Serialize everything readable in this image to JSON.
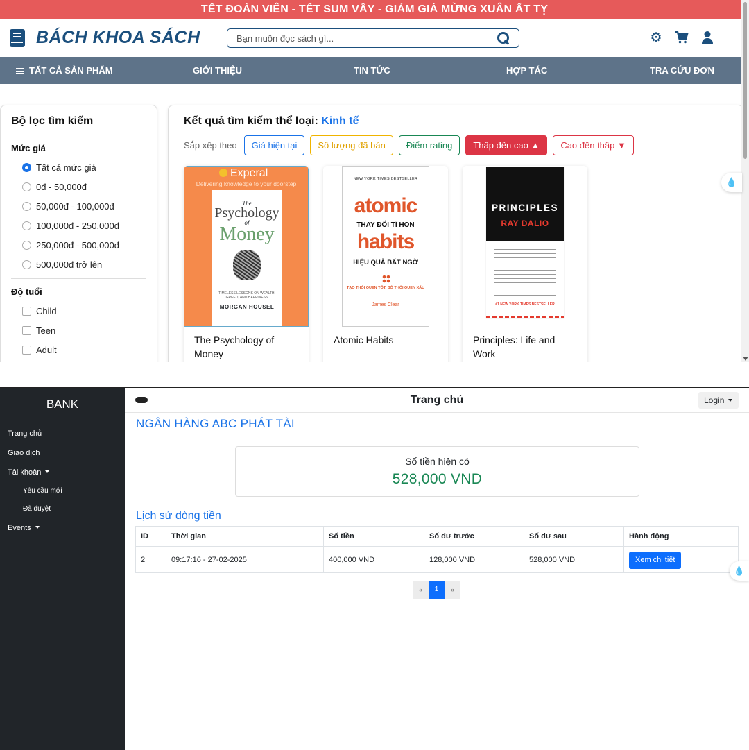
{
  "store": {
    "promo": "TẾT ĐOÀN VIÊN - TẾT SUM VẦY - GIẢM GIÁ MỪNG XUÂN ẤT TỴ",
    "logo": "BÁCH KHOA SÁCH",
    "search_placeholder": "Bạn muốn đọc sách gì...",
    "header_icons": [
      "gear-icon",
      "cart-icon",
      "user-icon"
    ],
    "nav": [
      "TẤT CẢ SẢN PHẨM",
      "GIỚI THIỆU",
      "TIN TỨC",
      "HỢP TÁC",
      "TRA CỨU ĐƠN"
    ],
    "filter": {
      "title": "Bộ lọc tìm kiếm",
      "price_title": "Mức giá",
      "prices": [
        "Tất cả mức giá",
        "0đ - 50,000đ",
        "50,000đ - 100,000đ",
        "100,000đ - 250,000đ",
        "250,000đ - 500,000đ",
        "500,000đ trở lên"
      ],
      "selected_price": "Tất cả mức giá",
      "age_title": "Độ tuổi",
      "ages": [
        "Child",
        "Teen",
        "Adult"
      ]
    },
    "results": {
      "title_prefix": "Kết quả tìm kiếm thể loại:",
      "category": "Kinh tế",
      "sort_label": "Sắp xếp theo",
      "sort_buttons": [
        "Giá hiện tại",
        "Số lượng đã bán",
        "Điểm rating",
        "Thấp đến cao ▲",
        "Cao đến thấp ▼"
      ],
      "active_sort": "Thấp đến cao ▲"
    },
    "books": [
      {
        "title": "The Psychology of Money",
        "cover": {
          "brand": "Experal",
          "tagline": "Delivering knowledge to your doorstep",
          "the": "The",
          "psychology": "Psychology",
          "of": "of",
          "money": "Money",
          "subtitle": "TIMELESS LESSONS ON WEALTH, GREED, AND HAPPINESS",
          "author": "MORGAN HOUSEL"
        }
      },
      {
        "title": "Atomic Habits",
        "cover": {
          "badge": "NEW YORK TIMES BESTSELLER",
          "word1": "atomic",
          "vn1": "THAY ĐỔI TÍ HON",
          "word2": "habits",
          "vn2": "HIỆU QUẢ BẤT NGỜ",
          "vn3": "TẠO THÓI QUEN TỐT, BỎ THÓI QUEN XẤU",
          "author": "James Clear"
        }
      },
      {
        "title": "Principles: Life and Work",
        "cover": {
          "word": "PRINCIPLES",
          "author": "RAY DALIO",
          "badge": "#1 NEW YORK TIMES BESTSELLER"
        }
      }
    ]
  },
  "bank": {
    "brand": "BANK",
    "sidebar": [
      "Trang chủ",
      "Giao dịch",
      "Tài khoản",
      "Yêu cầu mới",
      "Đã duyệt",
      "Events"
    ],
    "page_title": "Trang chủ",
    "login": "Login",
    "heading": "NGÂN HÀNG ABC PHÁT TÀI",
    "balance_label": "Số tiền hiện có",
    "balance_value": "528,000 VND",
    "history_title": "Lịch sử dòng tiền",
    "table": {
      "headers": [
        "ID",
        "Thời gian",
        "Số tiền",
        "Số dư trước",
        "Số dư sau",
        "Hành động"
      ],
      "rows": [
        {
          "id": "2",
          "time": "09:17:16 - 27-02-2025",
          "amount": "400,000 VND",
          "before": "128,000 VND",
          "after": "528,000 VND",
          "action": "Xem chi tiết"
        }
      ]
    },
    "pagination": [
      "«",
      "1",
      "»"
    ],
    "current_page": "1"
  },
  "colors": {
    "promo": "#e65a5a",
    "brand_blue": "#1b4f7d",
    "nav": "#5e7389",
    "link_blue": "#1a73e8",
    "danger": "#dc3545",
    "success": "#198754",
    "sidebar_dark": "#212529"
  }
}
